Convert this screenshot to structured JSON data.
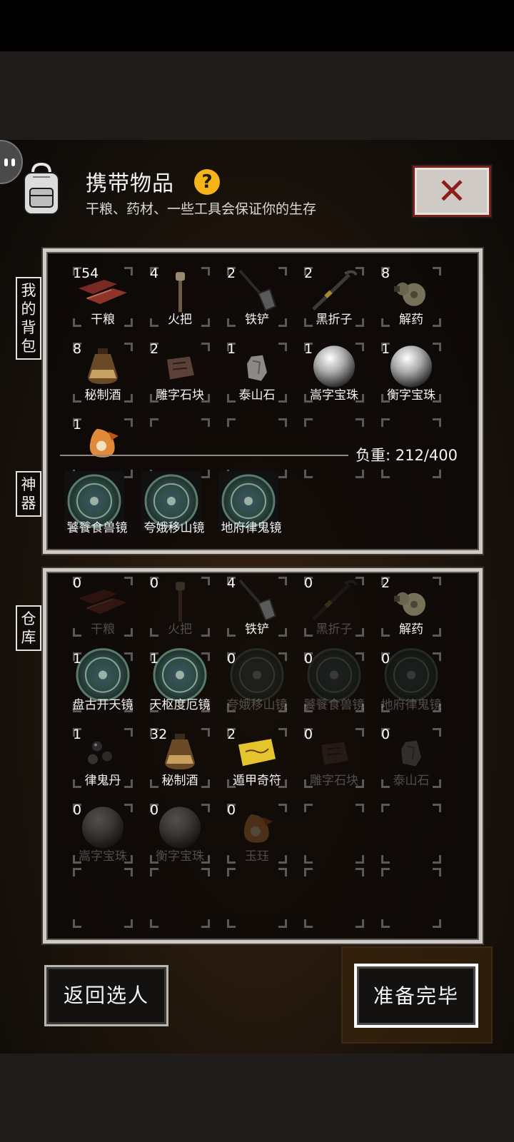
{
  "header": {
    "title": "携带物品",
    "help_symbol": "?",
    "subtitle": "干粮、药材、一些工具会保证你的生存",
    "close_symbol": "✕"
  },
  "backpack": {
    "label": "我的背包",
    "label_chars": [
      "我",
      "的",
      "背",
      "包"
    ],
    "items": [
      {
        "name": "干粮",
        "count": "154",
        "icon": "dried-meat-icon"
      },
      {
        "name": "火把",
        "count": "4",
        "icon": "torch-icon"
      },
      {
        "name": "铁铲",
        "count": "2",
        "icon": "shovel-icon"
      },
      {
        "name": "黑折子",
        "count": "2",
        "icon": "black-rod-icon"
      },
      {
        "name": "解药",
        "count": "8",
        "icon": "antidote-gourd-icon"
      },
      {
        "name": "秘制酒",
        "count": "8",
        "icon": "wine-jar-icon"
      },
      {
        "name": "雕字石块",
        "count": "2",
        "icon": "carved-stone-icon"
      },
      {
        "name": "泰山石",
        "count": "1",
        "icon": "taishan-stone-icon"
      },
      {
        "name": "嵩字宝珠",
        "count": "1",
        "icon": "pearl-icon"
      },
      {
        "name": "衡字宝珠",
        "count": "1",
        "icon": "pearl-icon"
      },
      {
        "name": "",
        "count": "1",
        "icon": "jade-ornament-icon"
      }
    ],
    "weight_label": "负重: 212/400"
  },
  "artifacts": {
    "label": "神器",
    "label_chars": [
      "神",
      "器"
    ],
    "items": [
      {
        "name": "饕餮食兽镜",
        "icon": "bronze-mirror-icon"
      },
      {
        "name": "夸娥移山镜",
        "icon": "bronze-mirror-icon"
      },
      {
        "name": "地府律鬼镜",
        "icon": "bronze-mirror-icon"
      }
    ]
  },
  "storage": {
    "label": "仓库",
    "label_chars": [
      "仓",
      "库"
    ],
    "items": [
      {
        "name": "干粮",
        "count": "0",
        "icon": "dried-meat-icon",
        "dim": true
      },
      {
        "name": "火把",
        "count": "0",
        "icon": "torch-icon",
        "dim": true
      },
      {
        "name": "铁铲",
        "count": "4",
        "icon": "shovel-icon",
        "dim": false
      },
      {
        "name": "黑折子",
        "count": "0",
        "icon": "black-rod-icon",
        "dim": true
      },
      {
        "name": "解药",
        "count": "2",
        "icon": "antidote-gourd-icon",
        "dim": false
      },
      {
        "name": "盘古开天镜",
        "count": "1",
        "icon": "bronze-mirror-icon",
        "dim": false
      },
      {
        "name": "天枢度厄镜",
        "count": "1",
        "icon": "bronze-mirror-icon",
        "dim": false
      },
      {
        "name": "夸娥移山镜",
        "count": "0",
        "icon": "bronze-mirror-icon",
        "dim": true
      },
      {
        "name": "饕餮食兽镜",
        "count": "0",
        "icon": "bronze-mirror-icon",
        "dim": true
      },
      {
        "name": "地府律鬼镜",
        "count": "0",
        "icon": "bronze-mirror-icon",
        "dim": true
      },
      {
        "name": "律鬼丹",
        "count": "1",
        "icon": "pills-icon",
        "dim": false
      },
      {
        "name": "秘制酒",
        "count": "32",
        "icon": "wine-jar-icon",
        "dim": false
      },
      {
        "name": "遁甲奇符",
        "count": "2",
        "icon": "talisman-icon",
        "dim": false
      },
      {
        "name": "雕字石块",
        "count": "0",
        "icon": "carved-stone-icon",
        "dim": true
      },
      {
        "name": "泰山石",
        "count": "0",
        "icon": "taishan-stone-icon",
        "dim": true
      },
      {
        "name": "嵩字宝珠",
        "count": "0",
        "icon": "pearl-icon",
        "dim": true
      },
      {
        "name": "衡字宝珠",
        "count": "0",
        "icon": "pearl-icon",
        "dim": true
      },
      {
        "name": "玉珏",
        "count": "0",
        "icon": "jade-ornament-icon",
        "dim": true
      }
    ]
  },
  "buttons": {
    "back": "返回选人",
    "ready": "准备完毕"
  },
  "colors": {
    "help_badge": "#f5b418",
    "close_x": "#8c1d18",
    "panel_border": "#cfcac3"
  }
}
